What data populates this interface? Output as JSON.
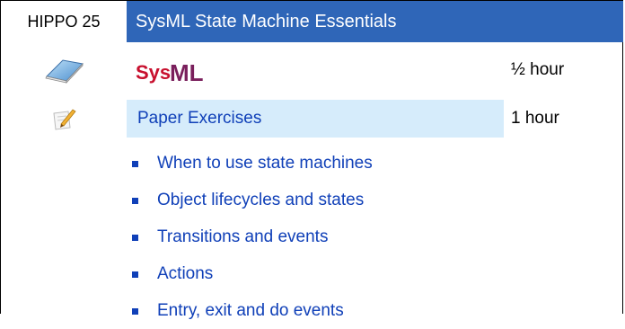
{
  "header": {
    "code": "HIPPO 25",
    "title": "SysML State Machine Essentials"
  },
  "sessions": [
    {
      "icon": "book-icon",
      "label_logo": "SysML",
      "duration": "½ hour"
    },
    {
      "icon": "pencil-paper-icon",
      "label": "Paper Exercises",
      "duration": "1 hour"
    }
  ],
  "topics": [
    "When to use state machines",
    "Object lifecycles and states",
    "Transitions and events",
    "Actions",
    "Entry, exit and do events"
  ],
  "colors": {
    "title_bar": "#2f66b8",
    "exercise_highlight": "#d6ecfb",
    "topic_text": "#1040b8",
    "logo_sys": "#c8102e",
    "logo_ml": "#7a1f5c"
  }
}
